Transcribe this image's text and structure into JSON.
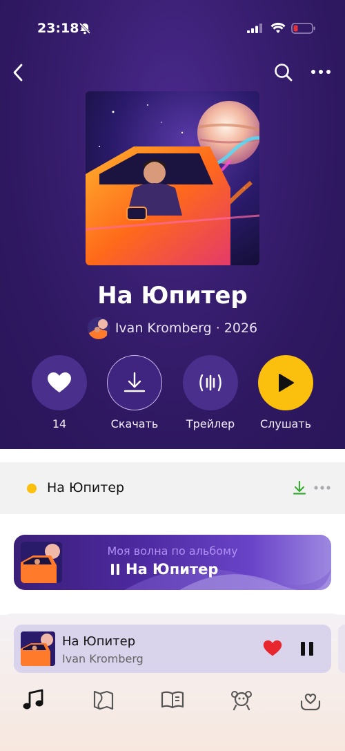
{
  "status_bar": {
    "time": "23:18"
  },
  "album": {
    "title": "На Юпитер",
    "artist_line": "Ivan Kromberg · 2026"
  },
  "actions": [
    {
      "icon": "heart-icon",
      "label": "14"
    },
    {
      "icon": "download-icon",
      "label": "Скачать"
    },
    {
      "icon": "trailer-icon",
      "label": "Трейлер"
    },
    {
      "icon": "play-icon",
      "label": "Слушать"
    }
  ],
  "tracks": [
    {
      "title": "На Юпитер"
    }
  ],
  "wave_banner": {
    "subtitle": "Моя волна по альбому",
    "title": "На Юпитер"
  },
  "mini_player": {
    "title": "На Юпитер",
    "artist": "Ivan Kromberg"
  },
  "tab_bar": [
    "music-note-icon",
    "map-icon",
    "book-icon",
    "kids-icon",
    "heart-box-icon"
  ],
  "colors": {
    "hero_bg": "#2e1860",
    "accent_yellow": "#fbbf0d",
    "like_red": "#e8262e",
    "download_green": "#3aa835"
  }
}
